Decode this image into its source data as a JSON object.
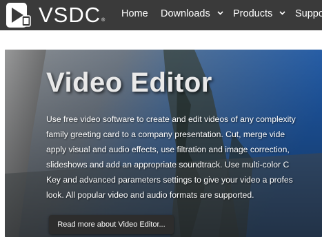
{
  "brand": {
    "name": "VSDC",
    "registered_mark": "®",
    "logo_color": "#ffffff"
  },
  "nav": {
    "items": [
      {
        "label": "Home",
        "has_dropdown": false
      },
      {
        "label": "Downloads",
        "has_dropdown": true
      },
      {
        "label": "Products",
        "has_dropdown": true
      },
      {
        "label": "Suppo",
        "has_dropdown": false
      }
    ]
  },
  "hero": {
    "title": "Video Editor",
    "description_lines": [
      "Use free video software to create and edit videos of any complexity",
      "family greeting card to a company presentation. Cut, merge vide",
      "apply visual and audio effects, use filtration and image correction,",
      "slideshows and add an appropriate soundtrack. Use multi-color C",
      "Key and advanced parameters settings to give your video a profes",
      "look. All popular video and audio formats are supported."
    ],
    "cta_label": "Read more about Video Editor..."
  },
  "colors": {
    "topbar": "#3a3a3a",
    "button": "#2d2d2d",
    "text": "#ffffff"
  }
}
